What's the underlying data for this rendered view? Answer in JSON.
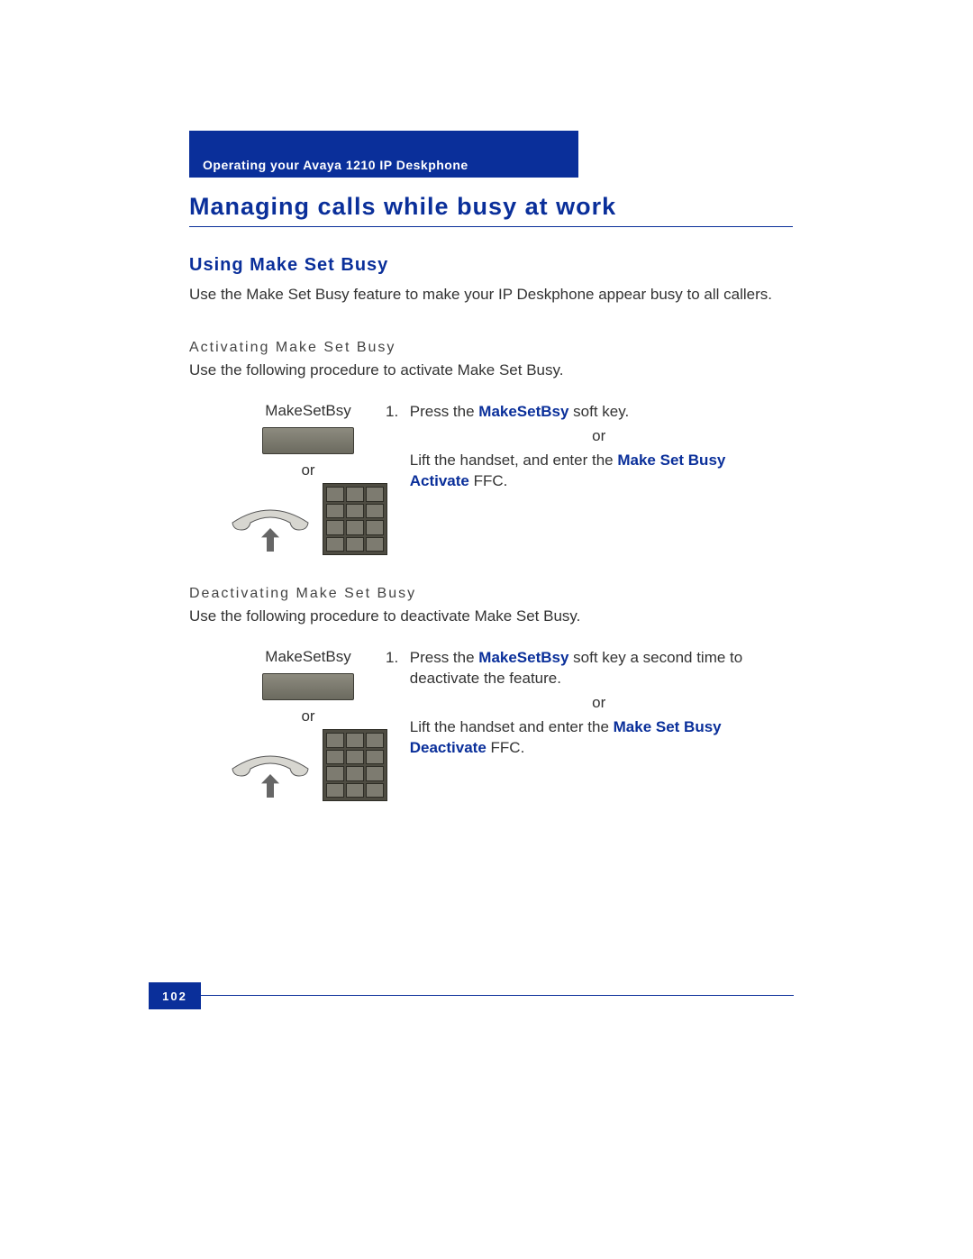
{
  "header": {
    "chapter": "Operating your Avaya 1210 IP Deskphone"
  },
  "title": "Managing calls while busy at work",
  "section": {
    "heading": "Using Make Set Busy",
    "intro": "Use the Make Set Busy feature to make your IP Deskphone appear busy to all callers."
  },
  "activate": {
    "heading": "Activating Make Set Busy",
    "lead": "Use the following procedure to activate Make Set Busy.",
    "icon_label": "MakeSetBsy",
    "or": "or",
    "step_num": "1.",
    "step_a_pre": "Press the ",
    "step_a_kw": "MakeSetBsy",
    "step_a_post": " soft key.",
    "step_or": "or",
    "step_b_pre": "Lift the handset, and enter the ",
    "step_b_kw": "Make Set Busy Activate",
    "step_b_post": " FFC."
  },
  "deactivate": {
    "heading": "Deactivating Make Set Busy",
    "lead": "Use the following procedure to deactivate Make Set Busy.",
    "icon_label": "MakeSetBsy",
    "or": "or",
    "step_num": "1.",
    "step_a_pre": "Press the ",
    "step_a_kw": "MakeSetBsy",
    "step_a_post": " soft key a second time to deactivate the feature.",
    "step_or": "or",
    "step_b_pre": "Lift the handset and enter the ",
    "step_b_kw": "Make Set Busy Deactivate",
    "step_b_post": " FFC."
  },
  "footer": {
    "page": "102"
  }
}
